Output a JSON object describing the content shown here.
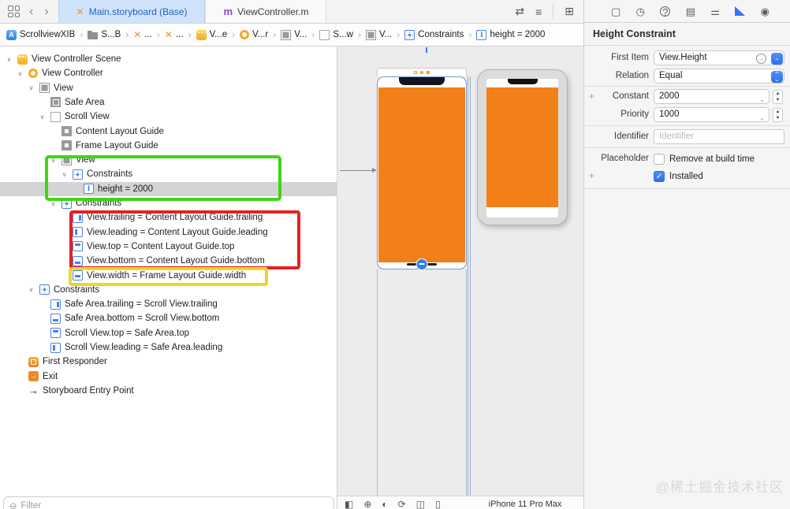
{
  "tab_bar": {
    "tabs": [
      {
        "name": "tab-main-storyboard",
        "label": "Main.storyboard (Base)",
        "icon": "x",
        "active": true
      },
      {
        "name": "tab-viewcontroller-m",
        "label": "ViewController.m",
        "icon": "m",
        "active": false
      }
    ],
    "right_icons": [
      {
        "name": "swap-editors-icon",
        "glyph": "⇄"
      },
      {
        "name": "list-lines-icon",
        "glyph": "≡"
      },
      {
        "name": "add-editor-icon",
        "glyph": "⊞"
      }
    ]
  },
  "breadcrumb": {
    "items": [
      {
        "name": "crumb-project",
        "label": "ScrollviewXIB",
        "icon": "app"
      },
      {
        "name": "crumb-folder",
        "label": "S...B",
        "icon": "folder"
      },
      {
        "name": "crumb-storyboard-1",
        "label": "...",
        "icon": "x"
      },
      {
        "name": "crumb-storyboard-2",
        "label": "...",
        "icon": "x"
      },
      {
        "name": "crumb-scene",
        "label": "V...e",
        "icon": "scene"
      },
      {
        "name": "crumb-view-controller",
        "label": "V...r",
        "icon": "vc"
      },
      {
        "name": "crumb-view-1",
        "label": "V...",
        "icon": "view"
      },
      {
        "name": "crumb-scroll-view",
        "label": "S...w",
        "icon": "view-outline"
      },
      {
        "name": "crumb-view-2",
        "label": "V...",
        "icon": "view"
      },
      {
        "name": "crumb-constraints",
        "label": "Constraints",
        "icon": "constraints"
      },
      {
        "name": "crumb-height-constraint",
        "label": "height = 2000",
        "icon": "c c-height"
      }
    ]
  },
  "outline": {
    "items": [
      {
        "label": "View Controller Scene",
        "depth": 0,
        "icon": "scene",
        "chevron": true
      },
      {
        "label": "View Controller",
        "depth": 1,
        "icon": "vc",
        "chevron": true
      },
      {
        "label": "View",
        "depth": 2,
        "icon": "view",
        "chevron": true
      },
      {
        "label": "Safe Area",
        "depth": 3,
        "icon": "safe",
        "chevron": false
      },
      {
        "label": "Scroll View",
        "depth": 3,
        "icon": "view-outline",
        "chevron": true
      },
      {
        "label": "Content Layout Guide",
        "depth": 4,
        "icon": "guide",
        "chevron": false
      },
      {
        "label": "Frame Layout Guide",
        "depth": 4,
        "icon": "guide",
        "chevron": false
      },
      {
        "label": "View",
        "depth": 4,
        "icon": "view",
        "chevron": true
      },
      {
        "label": "Constraints",
        "depth": 5,
        "icon": "constraints",
        "chevron": true
      },
      {
        "label": "height = 2000",
        "depth": 6,
        "icon": "c c-height",
        "chevron": false,
        "selected": true
      },
      {
        "label": "Constraints",
        "depth": 4,
        "icon": "constraints",
        "chevron": true
      },
      {
        "label": "View.trailing = Content Layout Guide.trailing",
        "depth": 5,
        "icon": "c c-trailing"
      },
      {
        "label": "View.leading = Content Layout Guide.leading",
        "depth": 5,
        "icon": "c c-leading"
      },
      {
        "label": "View.top = Content Layout Guide.top",
        "depth": 5,
        "icon": "c c-top"
      },
      {
        "label": "View.bottom = Content Layout Guide.bottom",
        "depth": 5,
        "icon": "c c-bottom"
      },
      {
        "label": "View.width = Frame Layout Guide.width",
        "depth": 5,
        "icon": "c c-width"
      },
      {
        "label": "Constraints",
        "depth": 2,
        "icon": "constraints",
        "chevron": true
      },
      {
        "label": "Safe Area.trailing = Scroll View.trailing",
        "depth": 3,
        "icon": "c c-trailing"
      },
      {
        "label": "Safe Area.bottom = Scroll View.bottom",
        "depth": 3,
        "icon": "c c-bottom"
      },
      {
        "label": "Scroll View.top = Safe Area.top",
        "depth": 3,
        "icon": "c c-top"
      },
      {
        "label": "Scroll View.leading = Safe Area.leading",
        "depth": 3,
        "icon": "c c-leading"
      },
      {
        "label": "First Responder",
        "depth": 1,
        "icon": "first-responder"
      },
      {
        "label": "Exit",
        "depth": 1,
        "icon": "exit"
      },
      {
        "label": "Storyboard Entry Point",
        "depth": 1,
        "icon": "entry-arrow"
      }
    ],
    "filter_placeholder": "Filter"
  },
  "canvas": {
    "device_label": "iPhone 11 Pro Max",
    "toolbar_icons": [
      {
        "name": "adjust-editor-icon",
        "glyph": "◧"
      },
      {
        "name": "add-device-icon",
        "glyph": "⊕"
      },
      {
        "name": "appearance-icon",
        "glyph": "◐"
      },
      {
        "name": "orientation-icon",
        "glyph": "⟳"
      },
      {
        "name": "layout-columns-icon",
        "glyph": "◫"
      },
      {
        "name": "device-icon",
        "glyph": "▯"
      }
    ]
  },
  "inspector": {
    "tabs": [
      {
        "name": "file-inspector-icon",
        "glyph": "▢"
      },
      {
        "name": "history-inspector-icon",
        "glyph": "◷"
      },
      {
        "name": "help-inspector-icon",
        "glyph": "?"
      },
      {
        "name": "identity-inspector-icon",
        "glyph": "▤"
      },
      {
        "name": "attributes-inspector-icon",
        "glyph": "⚌"
      },
      {
        "name": "size-inspector-icon",
        "glyph": "",
        "active": true
      },
      {
        "name": "connections-inspector-icon",
        "glyph": "◉"
      }
    ],
    "title": "Height Constraint",
    "first_item_label": "First Item",
    "first_item_value": "View.Height",
    "relation_label": "Relation",
    "relation_value": "Equal",
    "constant_label": "Constant",
    "constant_value": "2000",
    "priority_label": "Priority",
    "priority_value": "1000",
    "identifier_label": "Identifier",
    "identifier_placeholder": "Identifier",
    "placeholder_label": "Placeholder",
    "placeholder_checkbox_label": "Remove at build time",
    "installed_checkbox_label": "Installed",
    "add_row_glyph": "+"
  },
  "annotations": {
    "green_box_color": "#3fd414",
    "red_box_color": "#e32222",
    "yellow_box_color": "#f2d426"
  },
  "colors": {
    "accent_blue": "#3478f6",
    "view_orange": "#f28019",
    "selected_tab_bg": "#cfe3fa",
    "selected_row_bg": "#d4d4d4"
  },
  "watermark": "@稀土掘金技术社区"
}
